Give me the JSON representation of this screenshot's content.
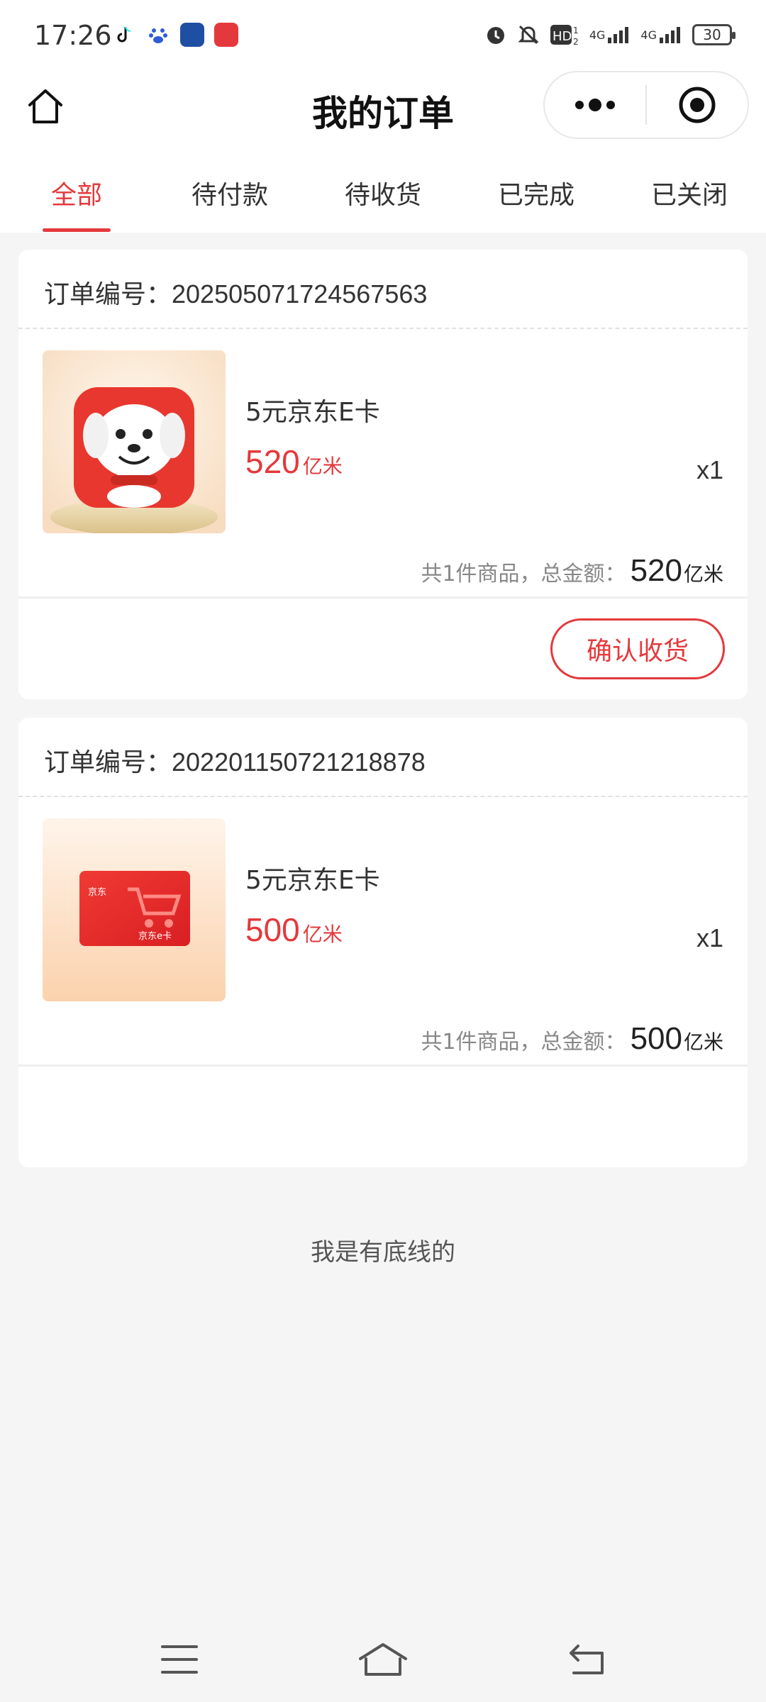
{
  "status_bar": {
    "time": "17:26",
    "network_1": "4G",
    "network_2": "4G",
    "battery": "30"
  },
  "header": {
    "title": "我的订单"
  },
  "tabs": [
    {
      "label": "全部",
      "active": true
    },
    {
      "label": "待付款",
      "active": false
    },
    {
      "label": "待收货",
      "active": false
    },
    {
      "label": "已完成",
      "active": false
    },
    {
      "label": "已关闭",
      "active": false
    }
  ],
  "orders": [
    {
      "order_label": "订单编号：",
      "order_no": "202505071724567563",
      "item_name": "5元京东E卡",
      "price": "520",
      "unit": "亿米",
      "qty": "x1",
      "summary_label": "共1件商品，总金额：",
      "total": "520",
      "action": "确认收货"
    },
    {
      "order_label": "订单编号：",
      "order_no": "202201150721218878",
      "item_name": "5元京东E卡",
      "price": "500",
      "unit": "亿米",
      "qty": "x1",
      "summary_label": "共1件商品，总金额：",
      "total": "500",
      "card_brand": "京东",
      "card_label": "京东e卡"
    }
  ],
  "footer_text": "我是有底线的",
  "colors": {
    "accent": "#e4393c",
    "background": "#f5f5f5"
  }
}
